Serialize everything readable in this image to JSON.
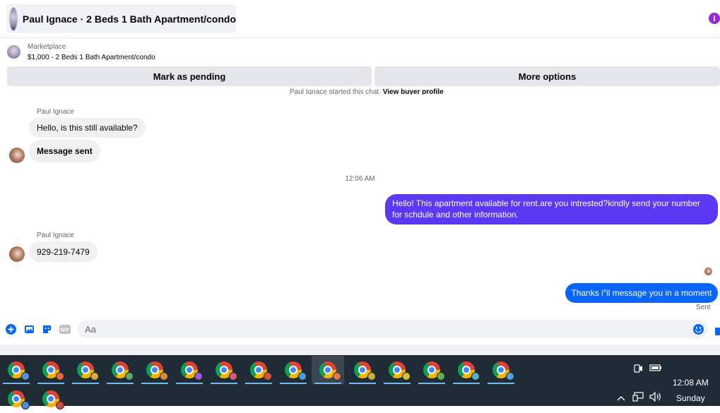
{
  "header": {
    "title": "Paul Ignace · 2 Beds 1 Bath Apartment/condo",
    "info_icon": "i"
  },
  "listing": {
    "category": "Marketplace",
    "price_title": "$1,000 - 2 Beds 1 Bath Apartment/condo",
    "mark_pending_label": "Mark as pending",
    "more_options_label": "More options"
  },
  "conversation": {
    "started_text": "Paul Ignace started this chat.",
    "view_profile_link": "View buyer profile",
    "sender_name_1": "Paul Ignace",
    "incoming_1": "Hello, is this still available?",
    "incoming_2": "Message sent",
    "timestamp": "12:06 AM",
    "outgoing_1_line1": "Hello! This apartment available for rent.are you intrested?kindly send your number",
    "outgoing_1_line2": "for schdule and other information.",
    "sender_name_2": "Paul Ignace",
    "incoming_3": "929-219-7479",
    "outgoing_2": "Thanks i\"il message you in a moment",
    "sent_status": "Sent"
  },
  "composer": {
    "placeholder": "Aa"
  },
  "taskbar": {
    "apps": [
      {
        "icon": "chrome-icon",
        "profile_color": "#5b8fd6",
        "open": true
      },
      {
        "icon": "chrome-icon",
        "profile_color": "#e06b3a",
        "open": true
      },
      {
        "icon": "chrome-icon",
        "profile_color": "#e0a93a",
        "open": true
      },
      {
        "icon": "chrome-icon",
        "profile_color": "#5aa86b",
        "open": true
      },
      {
        "icon": "chrome-icon",
        "profile_color": "#e08a3a",
        "open": true
      },
      {
        "icon": "chrome-icon",
        "profile_color": "#9b5ad6",
        "open": true
      },
      {
        "icon": "chrome-icon",
        "profile_color": "#d65a7a",
        "open": true
      },
      {
        "icon": "chrome-icon",
        "profile_color": "#d6553a",
        "open": true
      },
      {
        "icon": "chrome-icon",
        "profile_color": "#4a9fd6",
        "open": true
      },
      {
        "icon": "chrome-icon",
        "profile_color": "#e07a4a",
        "open": true,
        "active": true
      },
      {
        "icon": "chrome-icon",
        "profile_color": "#c6b03a",
        "open": true
      },
      {
        "icon": "chrome-icon",
        "profile_color": "#d6c03a",
        "open": true
      },
      {
        "icon": "chrome-icon",
        "profile_color": "#6ab04a",
        "open": true
      },
      {
        "icon": "chrome-icon",
        "profile_color": "#5ab0c0",
        "open": true
      },
      {
        "icon": "chrome-icon",
        "profile_color": "#5aa0d6",
        "open": true
      },
      {
        "icon": "chrome-icon",
        "profile_color": "#4a8ad6",
        "open": false
      },
      {
        "icon": "chrome-icon",
        "profile_color": "#d64a3a",
        "open": false
      }
    ],
    "time": "12:08 AM",
    "day": "Sunday"
  },
  "colors": {
    "outgoing_purple": "#5c38f5",
    "outgoing_blue": "#0866ff",
    "incoming_gray": "#f0f0f0",
    "taskbar_bg": "#1f2b35"
  }
}
